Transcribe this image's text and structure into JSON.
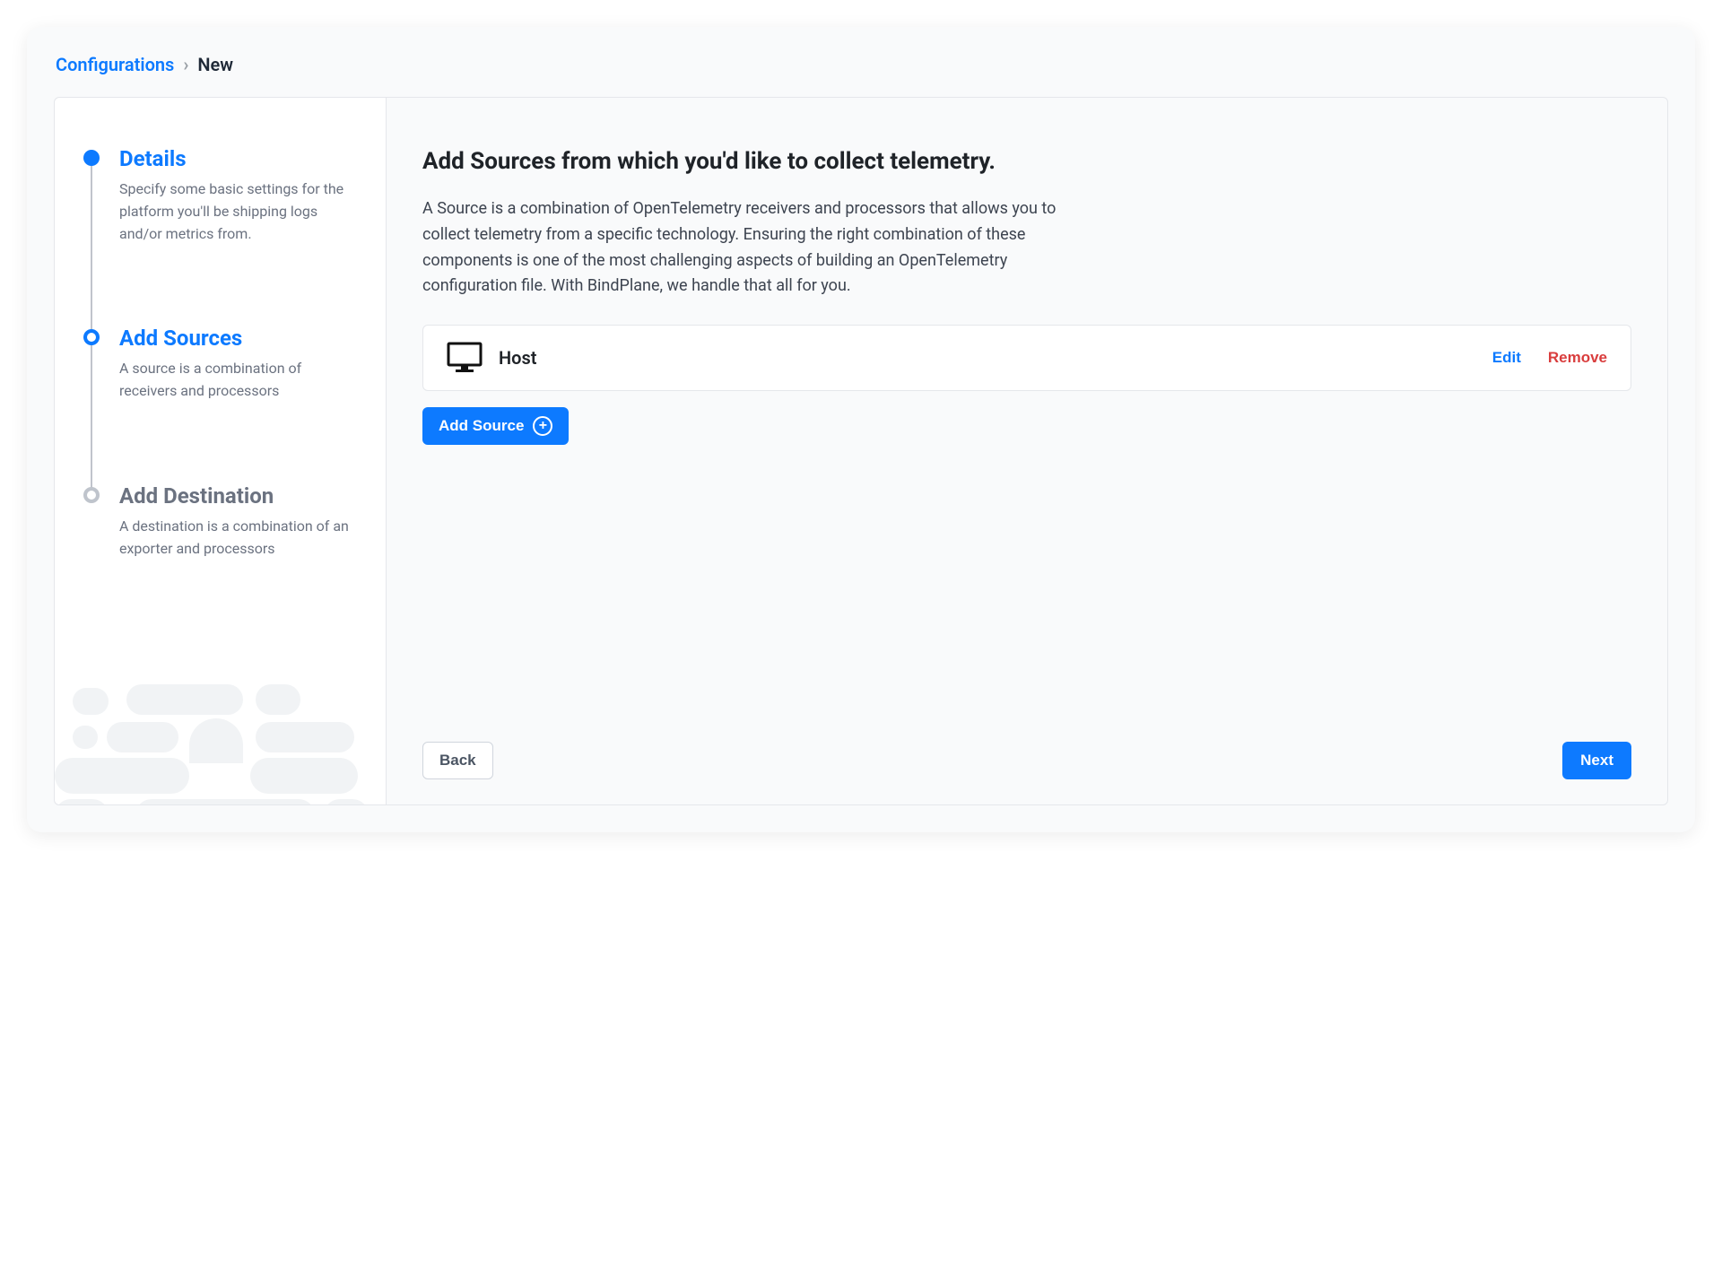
{
  "breadcrumb": {
    "root": "Configurations",
    "current": "New"
  },
  "steps": [
    {
      "title": "Details",
      "desc": "Specify some basic settings for the platform you'll be shipping logs and/or metrics from.",
      "state": "completed"
    },
    {
      "title": "Add Sources",
      "desc": "A source is a combination of receivers and processors",
      "state": "active"
    },
    {
      "title": "Add Destination",
      "desc": "A destination is a combination of an exporter and processors",
      "state": "inactive"
    }
  ],
  "main": {
    "heading": "Add Sources from which you'd like to collect telemetry.",
    "paragraph": "A Source is a combination of OpenTelemetry receivers and processors that allows you to collect telemetry from a specific technology. Ensuring the right combination of these components is one of the most challenging aspects of building an OpenTelemetry configuration file. With BindPlane, we handle that all for you."
  },
  "sources": [
    {
      "name": "Host",
      "icon": "monitor-icon"
    }
  ],
  "actions": {
    "edit": "Edit",
    "remove": "Remove",
    "add_source": "Add Source",
    "back": "Back",
    "next": "Next"
  }
}
